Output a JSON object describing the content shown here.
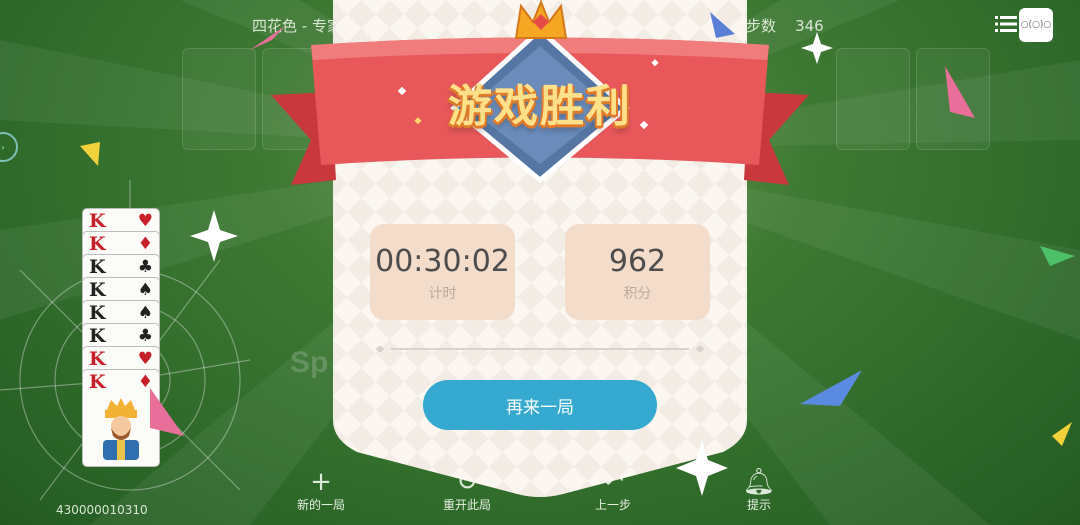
{
  "header": {
    "title": "四花色 - 专家",
    "steps_label": "步数",
    "steps_value": "346",
    "avatar_text": "○(○)○"
  },
  "game": {
    "seed": "430000010310",
    "stack_ranks": [
      "K",
      "K",
      "K",
      "K",
      "K",
      "K",
      "K",
      "K"
    ],
    "stack_suits": [
      "♥",
      "♦",
      "♣",
      "♠",
      "♠",
      "♣",
      "♥",
      "♦"
    ]
  },
  "toolbar": {
    "new_game": "新的一局",
    "restart": "重开此局",
    "undo": "上一步",
    "hint": "提示"
  },
  "dialog": {
    "title": "游戏胜利",
    "time_value": "00:30:02",
    "time_label": "计时",
    "score_value": "962",
    "score_label": "积分",
    "play_again": "再来一局"
  },
  "colors": {
    "felt": "#3f7a34",
    "ribbon": "#e8585a",
    "button": "#35a9cf",
    "stat_box": "#f4dccb"
  }
}
